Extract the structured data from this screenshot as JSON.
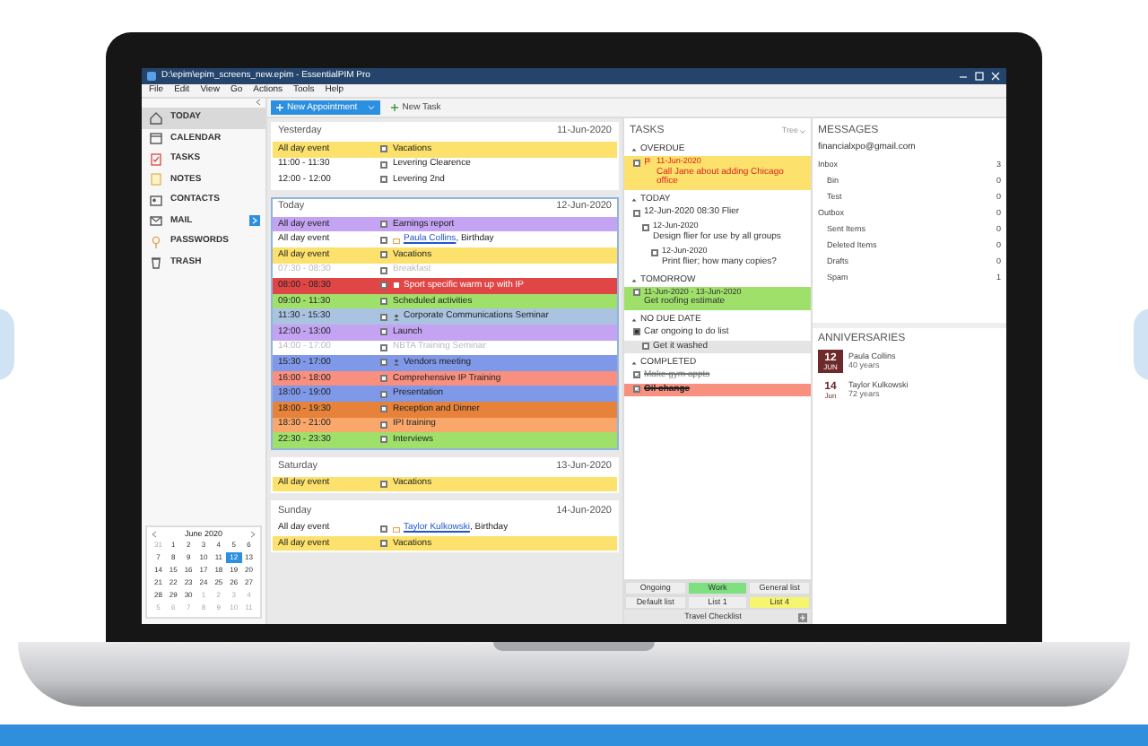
{
  "window": {
    "title": "D:\\epim\\epim_screens_new.epim - EssentialPIM Pro"
  },
  "menu": [
    "File",
    "Edit",
    "View",
    "Go",
    "Actions",
    "Tools",
    "Help"
  ],
  "toolbar": {
    "new_appointment": "New Appointment",
    "new_task": "New Task"
  },
  "sidebar": {
    "items": [
      {
        "label": "TODAY",
        "selected": true,
        "badge": false
      },
      {
        "label": "CALENDAR",
        "selected": false,
        "badge": false
      },
      {
        "label": "TASKS",
        "selected": false,
        "badge": false
      },
      {
        "label": "NOTES",
        "selected": false,
        "badge": false
      },
      {
        "label": "CONTACTS",
        "selected": false,
        "badge": false
      },
      {
        "label": "MAIL",
        "selected": false,
        "badge": true
      },
      {
        "label": "PASSWORDS",
        "selected": false,
        "badge": false
      },
      {
        "label": "TRASH",
        "selected": false,
        "badge": false
      }
    ]
  },
  "mini_calendar": {
    "title": "June 2020",
    "days": [
      {
        "d": "31",
        "muted": true,
        "selected": false
      },
      {
        "d": "1",
        "muted": false,
        "selected": false
      },
      {
        "d": "2",
        "muted": false,
        "selected": false
      },
      {
        "d": "3",
        "muted": false,
        "selected": false
      },
      {
        "d": "4",
        "muted": false,
        "selected": false
      },
      {
        "d": "5",
        "muted": false,
        "selected": false
      },
      {
        "d": "6",
        "muted": false,
        "selected": false
      },
      {
        "d": "7",
        "muted": false,
        "selected": false
      },
      {
        "d": "8",
        "muted": false,
        "selected": false
      },
      {
        "d": "9",
        "muted": false,
        "selected": false
      },
      {
        "d": "10",
        "muted": false,
        "selected": false
      },
      {
        "d": "11",
        "muted": false,
        "selected": false
      },
      {
        "d": "12",
        "muted": false,
        "selected": true
      },
      {
        "d": "13",
        "muted": false,
        "selected": false
      },
      {
        "d": "14",
        "muted": false,
        "selected": false
      },
      {
        "d": "15",
        "muted": false,
        "selected": false
      },
      {
        "d": "16",
        "muted": false,
        "selected": false
      },
      {
        "d": "17",
        "muted": false,
        "selected": false
      },
      {
        "d": "18",
        "muted": false,
        "selected": false
      },
      {
        "d": "19",
        "muted": false,
        "selected": false
      },
      {
        "d": "20",
        "muted": false,
        "selected": false
      },
      {
        "d": "21",
        "muted": false,
        "selected": false
      },
      {
        "d": "22",
        "muted": false,
        "selected": false
      },
      {
        "d": "23",
        "muted": false,
        "selected": false
      },
      {
        "d": "24",
        "muted": false,
        "selected": false
      },
      {
        "d": "25",
        "muted": false,
        "selected": false
      },
      {
        "d": "26",
        "muted": false,
        "selected": false
      },
      {
        "d": "27",
        "muted": false,
        "selected": false
      },
      {
        "d": "28",
        "muted": false,
        "selected": false
      },
      {
        "d": "29",
        "muted": false,
        "selected": false
      },
      {
        "d": "30",
        "muted": false,
        "selected": false
      },
      {
        "d": "1",
        "muted": true,
        "selected": false
      },
      {
        "d": "2",
        "muted": true,
        "selected": false
      },
      {
        "d": "3",
        "muted": true,
        "selected": false
      },
      {
        "d": "4",
        "muted": true,
        "selected": false
      },
      {
        "d": "5",
        "muted": true,
        "selected": false
      },
      {
        "d": "6",
        "muted": true,
        "selected": false
      },
      {
        "d": "7",
        "muted": true,
        "selected": false
      },
      {
        "d": "8",
        "muted": true,
        "selected": false
      },
      {
        "d": "9",
        "muted": true,
        "selected": false
      },
      {
        "d": "10",
        "muted": true,
        "selected": false
      },
      {
        "d": "11",
        "muted": true,
        "selected": false
      }
    ]
  },
  "calendar": {
    "days": [
      {
        "label": "Yesterday",
        "date": "11-Jun-2020",
        "current": false,
        "events": [
          {
            "kind": "event",
            "time": "All day event",
            "title": "Vacations",
            "color": "#fce16c",
            "dimmed": false
          },
          {
            "kind": "event",
            "time": "11:00 - 11:30",
            "title": "Levering Clearence",
            "dimmed": false
          },
          {
            "kind": "event",
            "time": "12:00 - 12:00",
            "title": "Levering 2nd",
            "dimmed": false
          }
        ]
      },
      {
        "label": "Today",
        "date": "12-Jun-2020",
        "current": true,
        "events": [
          {
            "kind": "event",
            "time": "All day event",
            "title": "Earnings report",
            "color": "#c3a3f2",
            "dimmed": false
          },
          {
            "kind": "birthday",
            "time": "All day event",
            "contact": "Paula Collins",
            "title": ", Birthday",
            "dimmed": false
          },
          {
            "kind": "event",
            "time": "All day event",
            "title": "Vacations",
            "color": "#fce16c",
            "dimmed": false
          },
          {
            "kind": "event",
            "time": "07:30 - 08:30",
            "title": "Breakfast",
            "dimmed": true
          },
          {
            "kind": "flagged",
            "time": "08:00 - 08:30",
            "title": "Sport specific warm up with IP",
            "color": "#e04646",
            "dimmed": false
          },
          {
            "kind": "event",
            "time": "09:00 - 11:30",
            "title": "Scheduled activities",
            "color": "#9fe06a",
            "dimmed": false
          },
          {
            "kind": "meeting",
            "time": "11:30 - 15:30",
            "title": "Corporate Communications Seminar",
            "color": "#a9c3e0",
            "dimmed": false
          },
          {
            "kind": "event",
            "time": "12:00 - 13:00",
            "title": "Launch",
            "color": "#c3a3f2",
            "dimmed": false
          },
          {
            "kind": "event",
            "time": "14:00 - 17:00",
            "title": "NBTA Training Seminar",
            "dimmed": true
          },
          {
            "kind": "meeting",
            "time": "15:30 - 17:00",
            "title": "Vendors meeting",
            "color": "#7f98e8",
            "dimmed": false
          },
          {
            "kind": "event",
            "time": "16:00 - 18:00",
            "title": "Comprehensive IP Training",
            "color": "#f98f7e",
            "dimmed": false
          },
          {
            "kind": "event",
            "time": "18:00 - 19:00",
            "title": "Presentation",
            "color": "#7f98e8",
            "dimmed": false
          },
          {
            "kind": "event",
            "time": "18:00 - 19:30",
            "title": "Reception and Dinner",
            "color": "#e6823a",
            "dimmed": false
          },
          {
            "kind": "event",
            "time": "18:30 - 21:00",
            "title": "IPI training",
            "color": "#f9a76a",
            "dimmed": false
          },
          {
            "kind": "event",
            "time": "22:30 - 23:30",
            "title": "Interviews",
            "color": "#9fe06a",
            "dimmed": false
          }
        ]
      },
      {
        "label": "Saturday",
        "date": "13-Jun-2020",
        "current": false,
        "events": [
          {
            "kind": "event",
            "time": "All day event",
            "title": "Vacations",
            "color": "#fce16c",
            "dimmed": false
          }
        ]
      },
      {
        "label": "Sunday",
        "date": "14-Jun-2020",
        "current": false,
        "events": [
          {
            "kind": "birthday",
            "time": "All day event",
            "contact": "Taylor Kulkowski",
            "title": ", Birthday",
            "dimmed": false
          },
          {
            "kind": "event",
            "time": "All day event",
            "title": "Vacations",
            "color": "#fce16c",
            "dimmed": false
          }
        ]
      }
    ]
  },
  "tasks": {
    "title": "TASKS",
    "view": "Tree",
    "sections": [
      {
        "label": "OVERDUE",
        "kind": "overdue",
        "items": [
          {
            "kind": "stacked",
            "flagged": true,
            "date": "11-Jun-2020",
            "title": "Call Jane about adding Chicago office",
            "color": "#fce16c",
            "checked": false,
            "partial": false
          }
        ]
      },
      {
        "label": "TODAY",
        "kind": "normal",
        "items": [
          {
            "kind": "inline",
            "flagged": false,
            "date": "12-Jun-2020 08:30",
            "title": "Flier",
            "checked": false,
            "partial": false,
            "children": [
              {
                "kind": "stacked",
                "flagged": false,
                "date": "12-Jun-2020",
                "title": "Design flier for use by all groups",
                "checked": false,
                "partial": false,
                "children": [
                  {
                    "kind": "stacked",
                    "flagged": false,
                    "date": "12-Jun-2020",
                    "title": "Print flier; how many copies?",
                    "checked": false,
                    "partial": false
                  }
                ]
              }
            ]
          }
        ]
      },
      {
        "label": "TOMORROW",
        "kind": "normal",
        "items": [
          {
            "kind": "stacked",
            "flagged": false,
            "date": "11-Jun-2020 - 13-Jun-2020",
            "title": "Get roofing estimate",
            "color": "#9fe06a",
            "checked": false,
            "partial": false
          }
        ]
      },
      {
        "label": "NO DUE DATE",
        "kind": "normal",
        "items": [
          {
            "kind": "inline",
            "flagged": false,
            "title": "Car ongoing to do list",
            "checked": false,
            "partial": true,
            "children": [
              {
                "kind": "inline",
                "flagged": false,
                "title": "Get it washed",
                "color": "#e4e4e4",
                "checked": false,
                "partial": false
              }
            ]
          }
        ]
      },
      {
        "label": "COMPLETED",
        "kind": "normal",
        "items": [
          {
            "kind": "inline",
            "flagged": false,
            "title": "Make gym appts",
            "checked": true,
            "partial": false
          },
          {
            "kind": "inline",
            "flagged": false,
            "title": "Oil change",
            "color": "#f98f7e",
            "checked": true,
            "partial": false
          }
        ]
      }
    ],
    "lists": [
      {
        "label": "Ongoing"
      },
      {
        "label": "Work",
        "color": "#7fe07f"
      },
      {
        "label": "General list"
      },
      {
        "label": "Default list"
      },
      {
        "label": "List 1"
      },
      {
        "label": "List 4",
        "color": "#f6f56e"
      }
    ],
    "footer": "Travel Checklist"
  },
  "messages": {
    "title": "MESSAGES",
    "account": "financialxpo@gmail.com",
    "folders": [
      {
        "name": "Inbox",
        "count": "3",
        "children": [
          {
            "name": "Bin",
            "count": "0"
          },
          {
            "name": "Test",
            "count": "0"
          }
        ]
      },
      {
        "name": "Outbox",
        "count": "0",
        "children": [
          {
            "name": "Sent Items",
            "count": "0"
          },
          {
            "name": "Deleted Items",
            "count": "0"
          },
          {
            "name": "Drafts",
            "count": "0"
          },
          {
            "name": "Spam",
            "count": "1"
          }
        ]
      }
    ]
  },
  "anniversaries": {
    "title": "ANNIVERSARIES",
    "items": [
      {
        "day": "12",
        "month": "JUN",
        "name": "Paula Collins",
        "years": "40 years",
        "highlight": true
      },
      {
        "day": "14",
        "month": "Jun",
        "name": "Taylor Kulkowski",
        "years": "72 years",
        "highlight": false
      }
    ]
  }
}
